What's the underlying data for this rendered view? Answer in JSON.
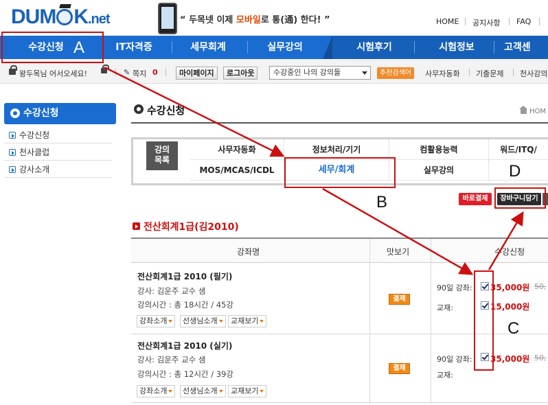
{
  "header": {
    "logo": {
      "left": "DUM",
      "right": "K",
      "suffix": ".net"
    },
    "slogan": {
      "prefix": "“ 두목넷 이제 ",
      "highlight": "모바일",
      "suffix": "로 통(通) 한다! ”"
    },
    "top_links": [
      "HOME",
      "공지사항",
      "FAQ"
    ]
  },
  "nav": {
    "items": [
      "수강신청",
      "IT자격증",
      "세무회계",
      "실무강의",
      "시험후기",
      "시험정보",
      "고객센"
    ]
  },
  "user_bar": {
    "greeting": "왕두목님 어서오세요!",
    "note_label": "쪽지",
    "note_count": "0",
    "mypage_button": "마이페이지",
    "logout_button": "로그아웃",
    "course_select": "수강중인 나의 강의들",
    "search_badge": "추천검색어",
    "keywords": [
      "사무자동화",
      "기출문제",
      "천사강의"
    ]
  },
  "sidebar": {
    "title": "수강신청",
    "items": [
      "수강신청",
      "천사클럽",
      "강사소개"
    ]
  },
  "main": {
    "title": "수강신청",
    "breadcrumb": "HOM",
    "tab_label": "강의\n목록",
    "tabs_row1": [
      "사무자동화",
      "정보처리/기기",
      "컴활용능력",
      "워드/ITQ/"
    ],
    "tabs_row2": [
      "MOS/MCAS/ICDL",
      "세무/회계",
      "실무강의",
      ""
    ],
    "pay_now_button": "바로결제",
    "cart_button": "장바구니담기",
    "section_title": "전산회계1급(김2010)",
    "table_headers": [
      "강좌명",
      "맛보기",
      "수강신청"
    ],
    "courses": [
      {
        "name": "전산회계1급 2010 (필기)",
        "teacher": "강사: 김운주 교수 샘",
        "time": "강의시간 : 총 18시간 / 45강",
        "buttons": [
          "강좌소개",
          "선생님소개",
          "교재보기"
        ],
        "preview": "결제",
        "option_label": "90일 강좌:",
        "option_price": "35,000원",
        "option_old": "50,",
        "book_label": "교재:",
        "book_price": "15,000원"
      },
      {
        "name": "전산회계1급 2010 (실기)",
        "teacher": "강사: 김운주 교수 샘",
        "time": "강의시간 : 총 12시간 / 39강",
        "buttons": [
          "강좌소개",
          "선생님소개",
          "교재보기"
        ],
        "preview": "결제",
        "option_label": "90일 강좌:",
        "option_price": "35,000원",
        "option_old": "50,",
        "book_label": "교재:",
        "book_price": ""
      }
    ]
  },
  "annotations": {
    "a": "A",
    "b": "B",
    "c": "C",
    "d": "D",
    "color": "#cc1010"
  }
}
